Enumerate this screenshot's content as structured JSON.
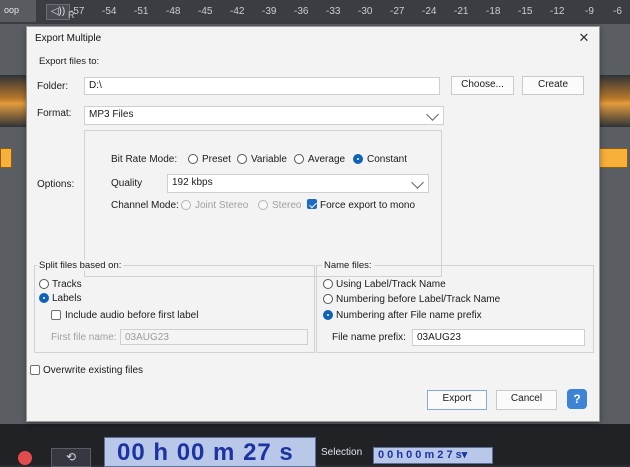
{
  "background": {
    "ruler_ticks": [
      "-57",
      "-54",
      "-51",
      "-48",
      "-45",
      "-42",
      "-39",
      "-36",
      "-33",
      "-30",
      "-27",
      "-24",
      "-21",
      "-18",
      "-15",
      "-12",
      "-9",
      "-6"
    ],
    "left_label": "oop",
    "audio_icon": "◁))",
    "audio_channel": "R",
    "timeline": "00 h 00 m 27 s",
    "selection_label": "Selection",
    "selection_time": "0 0 h 0 0 m 2 7 s▾"
  },
  "dialog": {
    "title": "Export Multiple",
    "close_label": "✕",
    "export_files_to": "Export files to:",
    "folder_label": "Folder:",
    "folder_value": "D:\\",
    "choose_label": "Choose...",
    "create_label": "Create",
    "format_label": "Format:",
    "format_value": "MP3 Files",
    "options_label": "Options:",
    "bit_rate_mode_label": "Bit Rate Mode:",
    "bit_rate_options": [
      "Preset",
      "Variable",
      "Average",
      "Constant"
    ],
    "quality_label": "Quality",
    "quality_value": "192 kbps",
    "channel_mode_label": "Channel Mode:",
    "channel_mode_joint": "Joint Stereo",
    "channel_mode_stereo": "Stereo",
    "force_mono_label": "Force export to mono",
    "split_files_title": "Split files based on:",
    "split_tracks": "Tracks",
    "split_labels": "Labels",
    "include_audio_label": "Include audio before first label",
    "first_file_name_label": "First file name:",
    "first_file_name_value": "03AUG23",
    "name_files_title": "Name files:",
    "name_using_label": "Using Label/Track Name",
    "name_numbering_before": "Numbering before Label/Track Name",
    "name_numbering_after": "Numbering after File name prefix",
    "file_name_prefix_label": "File name prefix:",
    "file_name_prefix_value": "03AUG23",
    "overwrite_label": "Overwrite existing files",
    "export_button": "Export",
    "cancel_button": "Cancel",
    "help_button": "?"
  }
}
